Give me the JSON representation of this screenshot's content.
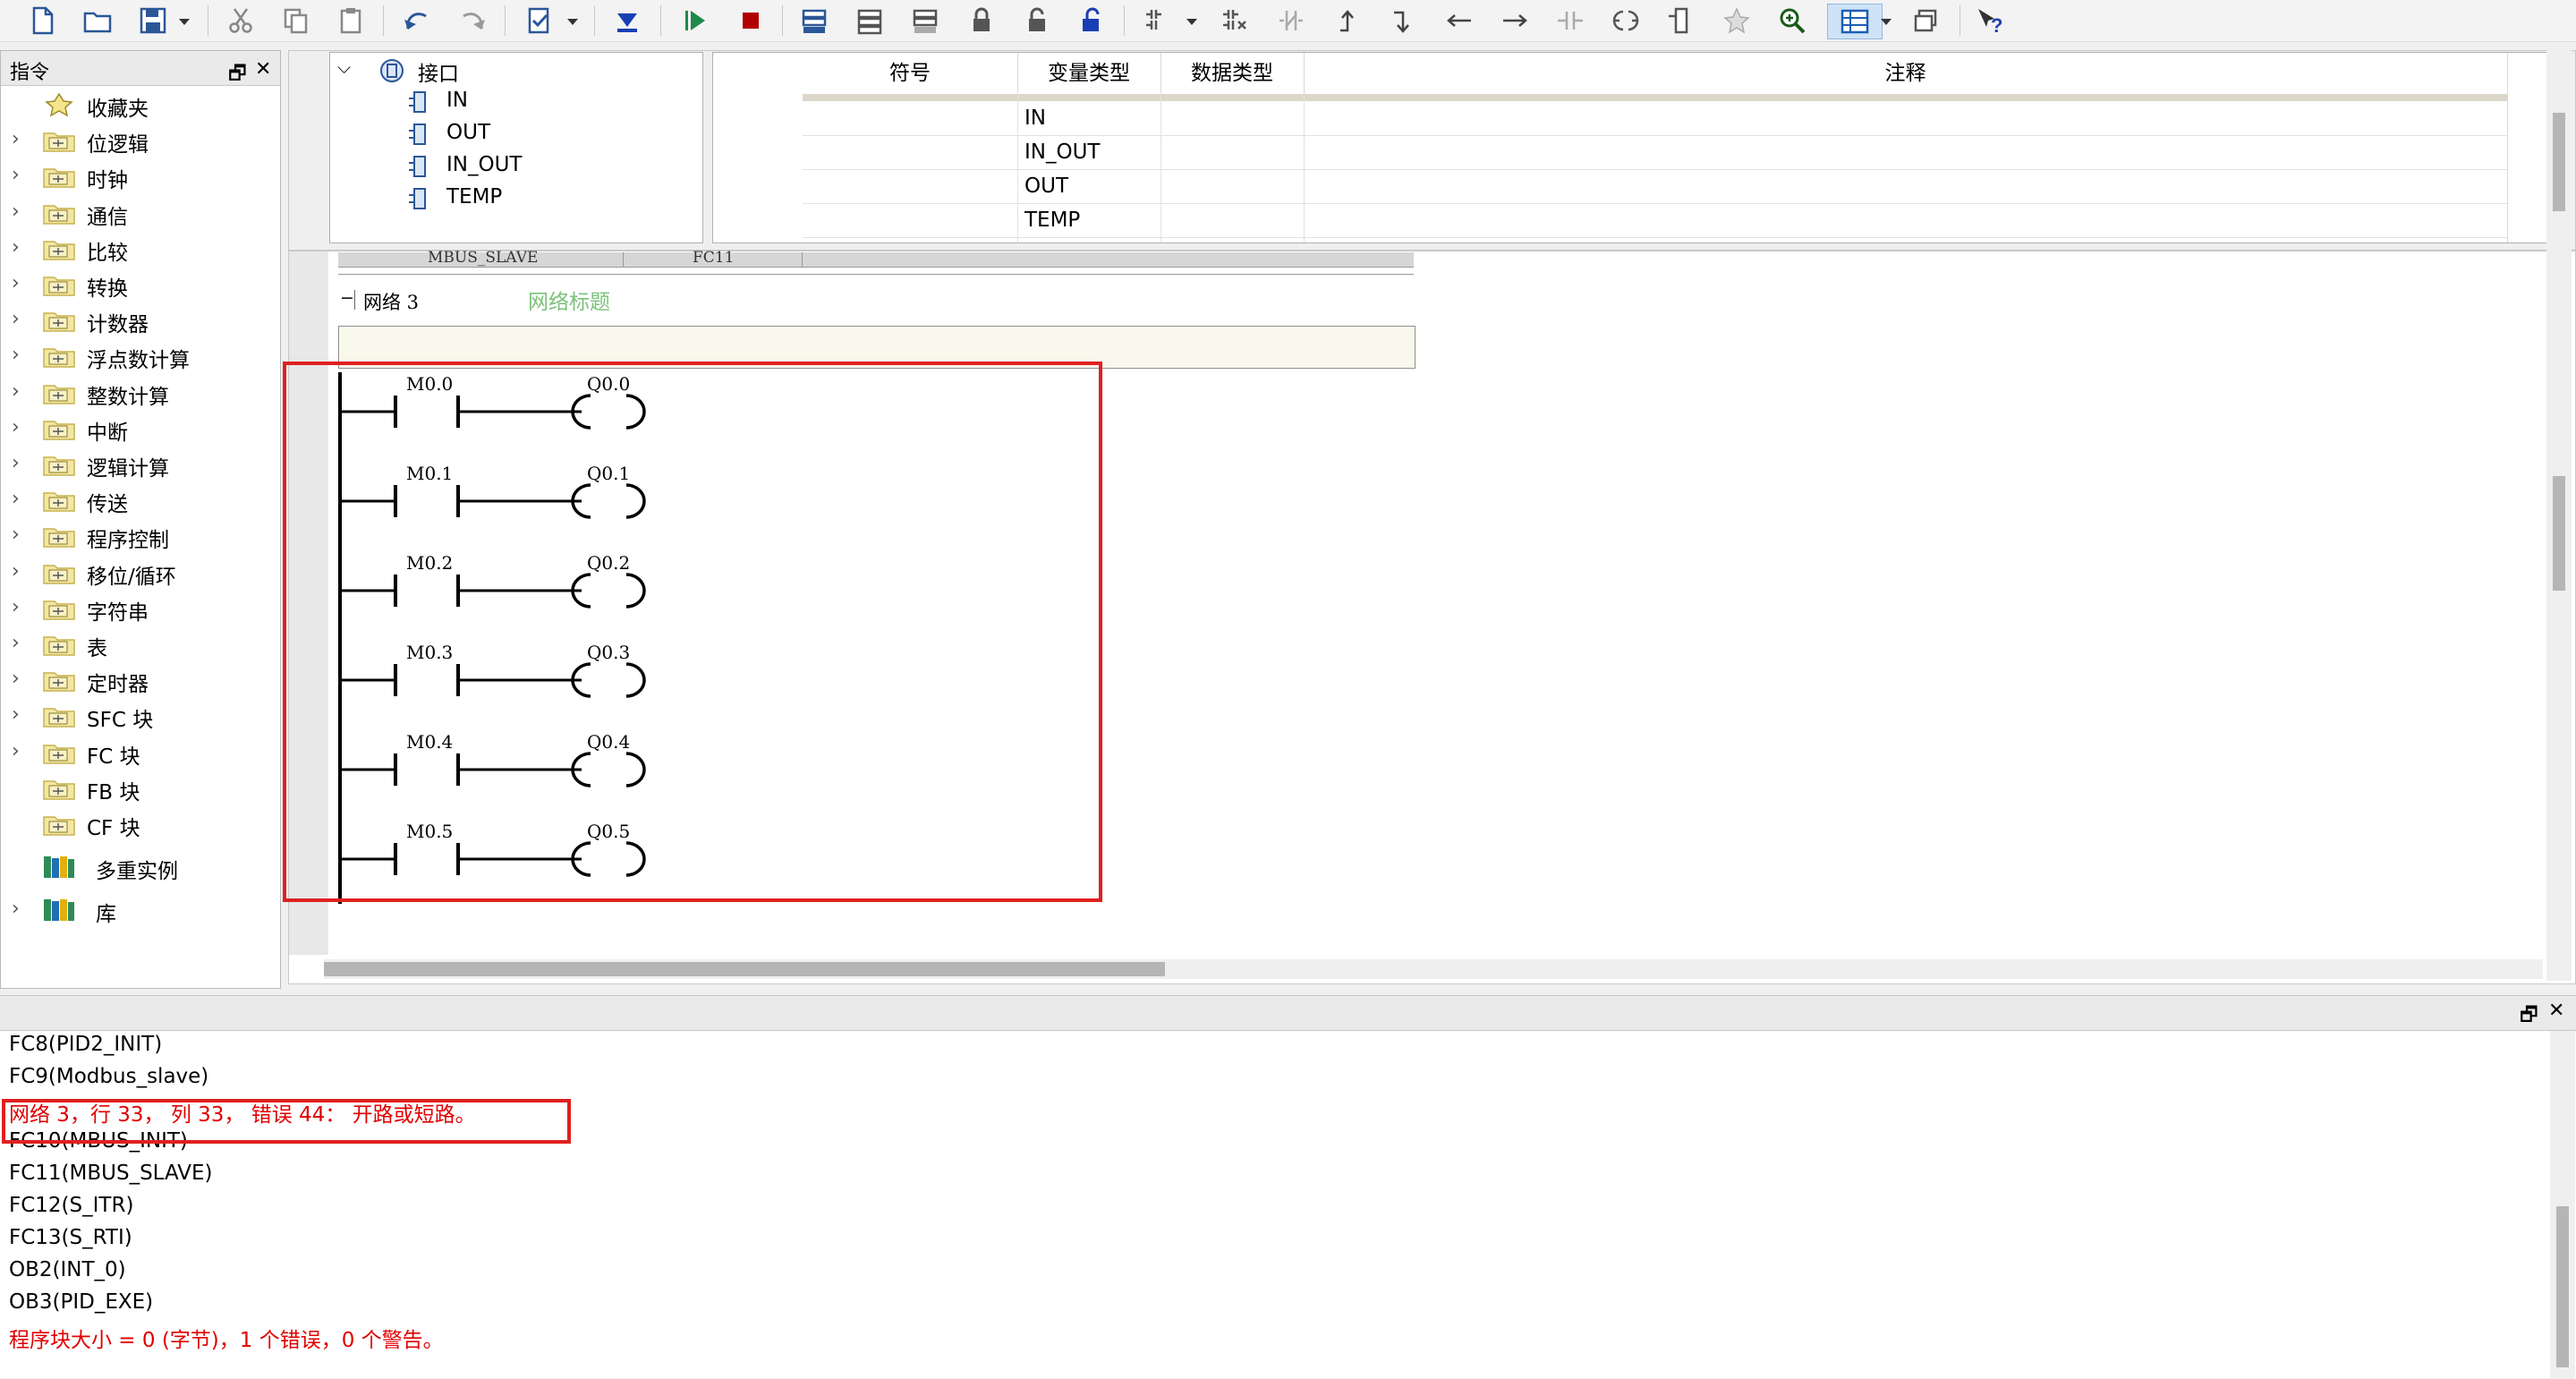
{
  "instructions_panel": {
    "title": "指令",
    "items": [
      {
        "label": "收藏夹",
        "expandable": false,
        "icon": "star-icon"
      },
      {
        "label": "位逻辑",
        "expandable": true,
        "icon": "bit-logic-folder-icon"
      },
      {
        "label": "时钟",
        "expandable": true,
        "icon": "clock-folder-icon"
      },
      {
        "label": "通信",
        "expandable": true,
        "icon": "communication-folder-icon"
      },
      {
        "label": "比较",
        "expandable": true,
        "icon": "compare-folder-icon"
      },
      {
        "label": "转换",
        "expandable": true,
        "icon": "convert-folder-icon"
      },
      {
        "label": "计数器",
        "expandable": true,
        "icon": "counter-folder-icon"
      },
      {
        "label": "浮点数计算",
        "expandable": true,
        "icon": "float-math-folder-icon"
      },
      {
        "label": "整数计算",
        "expandable": true,
        "icon": "integer-math-folder-icon"
      },
      {
        "label": "中断",
        "expandable": true,
        "icon": "interrupt-folder-icon"
      },
      {
        "label": "逻辑计算",
        "expandable": true,
        "icon": "logic-operation-folder-icon"
      },
      {
        "label": "传送",
        "expandable": true,
        "icon": "move-folder-icon"
      },
      {
        "label": "程序控制",
        "expandable": true,
        "icon": "program-control-folder-icon"
      },
      {
        "label": "移位/循环",
        "expandable": true,
        "icon": "shift-rotate-folder-icon"
      },
      {
        "label": "字符串",
        "expandable": true,
        "icon": "string-folder-icon"
      },
      {
        "label": "表",
        "expandable": true,
        "icon": "table-folder-icon"
      },
      {
        "label": "定时器",
        "expandable": true,
        "icon": "timer-folder-icon"
      },
      {
        "label": "SFC 块",
        "expandable": true,
        "icon": "sfc-block-folder-icon"
      },
      {
        "label": "FC 块",
        "expandable": true,
        "icon": "fc-block-folder-icon"
      },
      {
        "label": "FB 块",
        "expandable": false,
        "icon": "fb-block-folder-icon"
      },
      {
        "label": "CF 块",
        "expandable": false,
        "icon": "cf-block-folder-icon"
      },
      {
        "label": "多重实例",
        "expandable": false,
        "icon": "multi-instance-books-icon"
      },
      {
        "label": "库",
        "expandable": true,
        "icon": "library-books-icon"
      }
    ]
  },
  "interface_tree": {
    "root": "接口",
    "children": [
      "IN",
      "OUT",
      "IN_OUT",
      "TEMP"
    ]
  },
  "interface_table": {
    "headers": [
      "符号",
      "变量类型",
      "数据类型",
      "注释"
    ],
    "rows": [
      {
        "symbol": "",
        "var_type": "IN",
        "data_type": "",
        "comment": ""
      },
      {
        "symbol": "",
        "var_type": "IN_OUT",
        "data_type": "",
        "comment": ""
      },
      {
        "symbol": "",
        "var_type": "OUT",
        "data_type": "",
        "comment": ""
      },
      {
        "symbol": "",
        "var_type": "TEMP",
        "data_type": "",
        "comment": ""
      }
    ]
  },
  "editor": {
    "prev_row_cells": [
      "MBUS_SLAVE",
      "FC11"
    ],
    "network_toggle": "−",
    "network_name": "网络 3",
    "network_title": "网络标题",
    "rungs": [
      {
        "contact": "M0.0",
        "coil": "Q0.0"
      },
      {
        "contact": "M0.1",
        "coil": "Q0.1"
      },
      {
        "contact": "M0.2",
        "coil": "Q0.2"
      },
      {
        "contact": "M0.3",
        "coil": "Q0.3"
      },
      {
        "contact": "M0.4",
        "coil": "Q0.4"
      },
      {
        "contact": "M0.5",
        "coil": "Q0.5"
      }
    ]
  },
  "output": {
    "lines": [
      {
        "text": "FC8(PID2_INIT)",
        "error": false
      },
      {
        "text": "FC9(Modbus_slave)",
        "error": false
      },
      {
        "text": "网络 3，行 33， 列 33， 错误 44： 开路或短路。",
        "error": true
      },
      {
        "text": "FC10(MBUS_INIT)",
        "error": false
      },
      {
        "text": "FC11(MBUS_SLAVE)",
        "error": false
      },
      {
        "text": "FC12(S_ITR)",
        "error": false
      },
      {
        "text": "FC13(S_RTI)",
        "error": false
      },
      {
        "text": "OB2(INT_0)",
        "error": false
      },
      {
        "text": "OB3(PID_EXE)",
        "error": false
      },
      {
        "text": "程序块大小 = 0 (字节)，1 个错误，0 个警告。",
        "error": true
      }
    ]
  },
  "colors": {
    "error_red": "#e00000",
    "highlight_box": "#e02020",
    "title_green": "#7bc17b",
    "active_blue": "#1a5fb4"
  }
}
